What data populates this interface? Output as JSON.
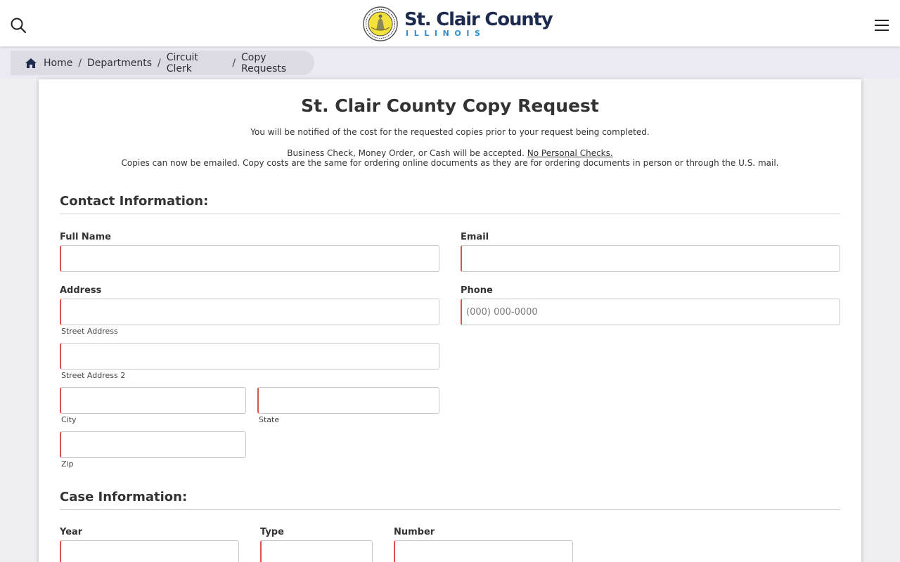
{
  "header": {
    "brand_name": "St. Clair County",
    "brand_sub": "ILLINOIS"
  },
  "breadcrumb": {
    "items": [
      "Home",
      "Departments",
      "Circuit Clerk",
      "Copy Requests"
    ],
    "separator": "/"
  },
  "form": {
    "title": "St. Clair County Copy Request",
    "notice": "You will be notified of the cost for the requested copies prior to your request being completed.",
    "payment_text": "Business Check, Money Order, or Cash will be accepted.",
    "payment_link": "No Personal Checks.",
    "email_note": "Copies can now be emailed. Copy costs are the same for ordering online documents as they are for ordering documents in person or through the U.S. mail.",
    "contact": {
      "heading": "Contact Information:",
      "full_name_label": "Full Name",
      "email_label": "Email",
      "address_label": "Address",
      "phone_label": "Phone",
      "phone_placeholder": "(000) 000-0000",
      "street_sub": "Street Address",
      "street2_sub": "Street Address 2",
      "city_sub": "City",
      "state_sub": "State",
      "zip_sub": "Zip"
    },
    "case": {
      "heading": "Case Information:",
      "year_label": "Year",
      "type_label": "Type",
      "number_label": "Number"
    }
  },
  "colors": {
    "brand_navy": "#1c2a4e",
    "brand_blue": "#2f8fd0",
    "required_red": "#d9534f"
  }
}
